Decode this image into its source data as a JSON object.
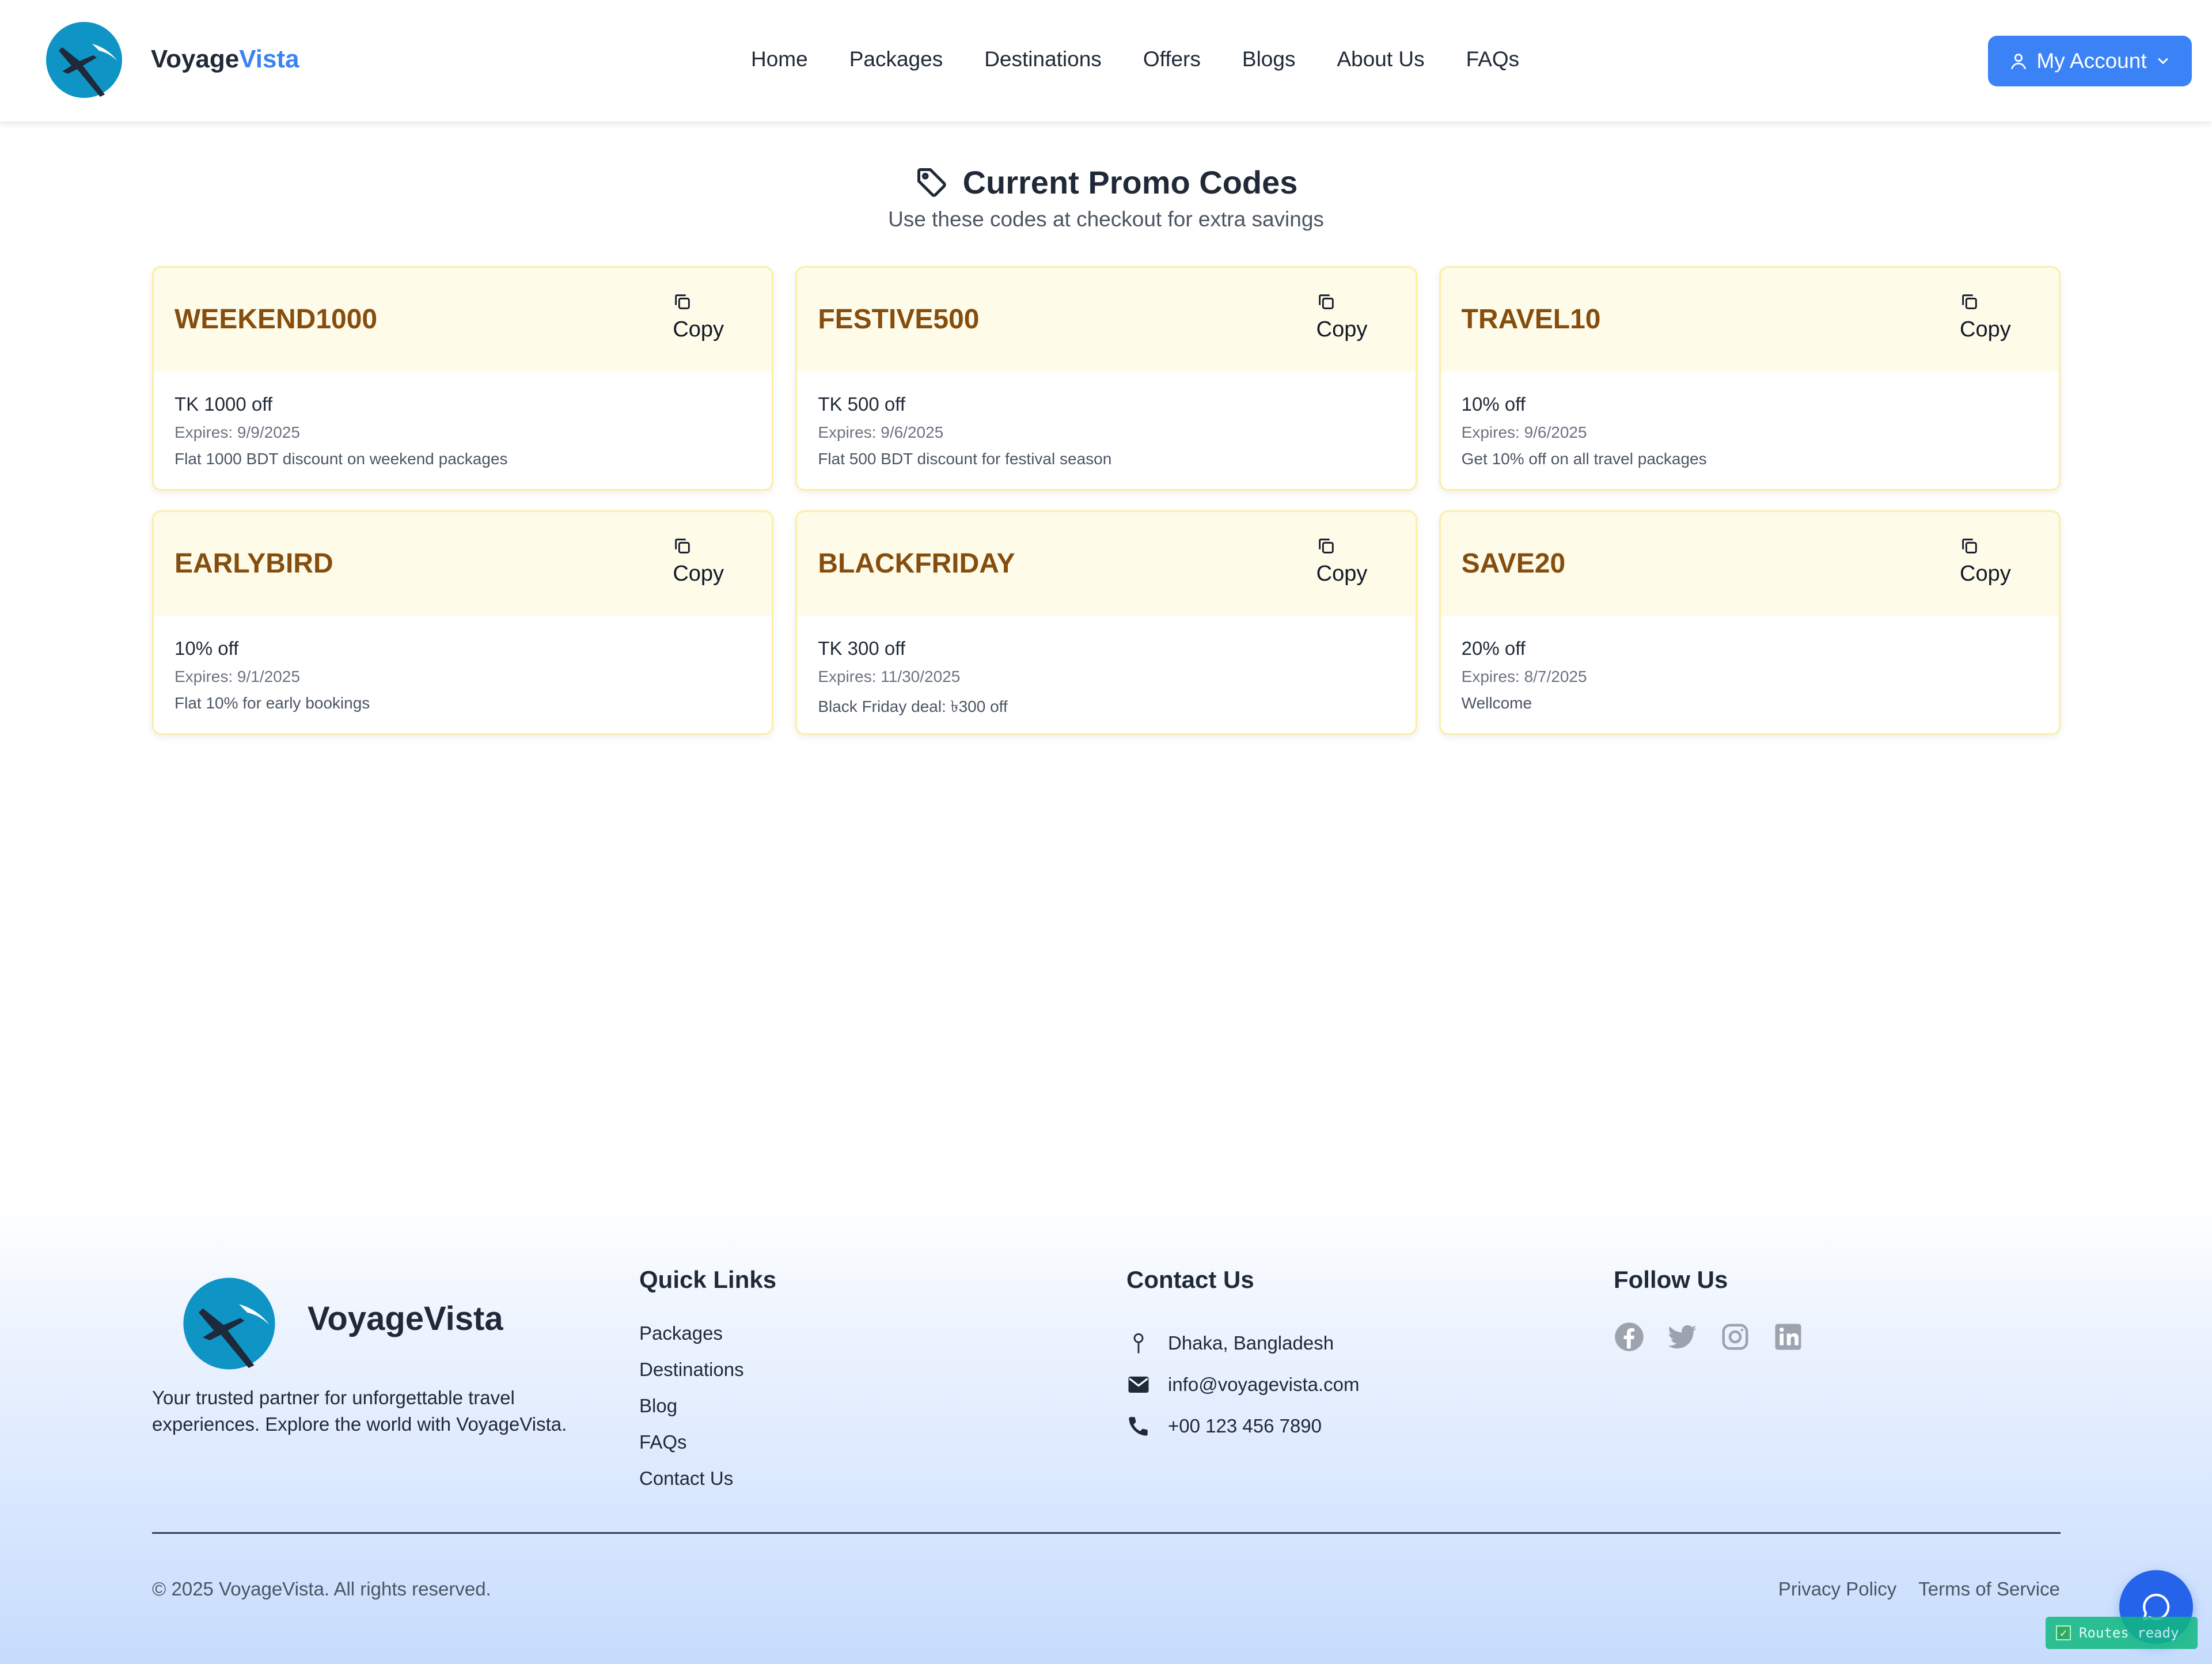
{
  "header": {
    "brand_first": "Voyage",
    "brand_second": "Vista",
    "nav": [
      "Home",
      "Packages",
      "Destinations",
      "Offers",
      "Blogs",
      "About Us",
      "FAQs"
    ],
    "account_label": "My Account",
    "account_icon": "user-icon",
    "account_caret": "chevron-down-icon"
  },
  "promo": {
    "title": "Current Promo Codes",
    "title_icon": "tag-icon",
    "subtitle": "Use these codes at checkout for extra savings",
    "copy_label": "Copy",
    "codes": [
      {
        "code": "WEEKEND1000",
        "discount": "TK 1000 off",
        "expires": "Expires: 9/9/2025",
        "description": "Flat 1000 BDT discount on weekend packages"
      },
      {
        "code": "FESTIVE500",
        "discount": "TK 500 off",
        "expires": "Expires: 9/6/2025",
        "description": "Flat 500 BDT discount for festival season"
      },
      {
        "code": "TRAVEL10",
        "discount": "10% off",
        "expires": "Expires: 9/6/2025",
        "description": "Get 10% off on all travel packages"
      },
      {
        "code": "EARLYBIRD",
        "discount": "10% off",
        "expires": "Expires: 9/1/2025",
        "description": "Flat 10% for early bookings"
      },
      {
        "code": "BLACKFRIDAY",
        "discount": "TK 300 off",
        "expires": "Expires: 11/30/2025",
        "description": "Black Friday deal: ৳300 off"
      },
      {
        "code": "SAVE20",
        "discount": "20% off",
        "expires": "Expires: 8/7/2025",
        "description": "Wellcome"
      }
    ]
  },
  "footer": {
    "brand": "VoyageVista",
    "tagline": "Your trusted partner for unforgettable travel experiences. Explore the world with VoyageVista.",
    "quick_links_title": "Quick Links",
    "quick_links": [
      "Packages",
      "Destinations",
      "Blog",
      "FAQs",
      "Contact Us"
    ],
    "contact_title": "Contact Us",
    "contact": {
      "address": "Dhaka, Bangladesh",
      "email": "info@voyagevista.com",
      "phone": "+00 123 456 7890"
    },
    "follow_title": "Follow Us",
    "social_icons": [
      "facebook-icon",
      "twitter-icon",
      "instagram-icon",
      "linkedin-icon"
    ],
    "copyright": "© 2025 VoyageVista. All rights reserved.",
    "privacy": "Privacy Policy",
    "terms": "Terms of Service"
  },
  "widgets": {
    "chat_icon": "chat-icon",
    "routes_status": "Routes ready"
  },
  "colors": {
    "accent": "#3b82f6",
    "promo_code_text": "#854d0e",
    "promo_card_header": "#fefbe8",
    "promo_card_border": "#fcefa6"
  }
}
